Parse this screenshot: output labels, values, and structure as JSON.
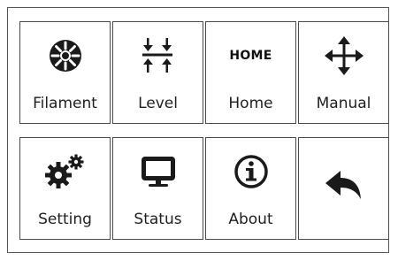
{
  "menu": {
    "tiles": [
      {
        "label": "Filament",
        "icon": "filament-icon"
      },
      {
        "label": "Level",
        "icon": "level-icon"
      },
      {
        "label": "Home",
        "icon": "home-icon",
        "icon_text": "HOME"
      },
      {
        "label": "Manual",
        "icon": "move-arrows-icon"
      },
      {
        "label": "Setting",
        "icon": "gears-icon"
      },
      {
        "label": "Status",
        "icon": "monitor-icon"
      },
      {
        "label": "About",
        "icon": "info-icon"
      },
      {
        "label": "",
        "icon": "back-arrow-icon"
      }
    ]
  },
  "colors": {
    "border": "#4a4a4a",
    "ink": "#1a1a1a",
    "background": "#ffffff"
  }
}
